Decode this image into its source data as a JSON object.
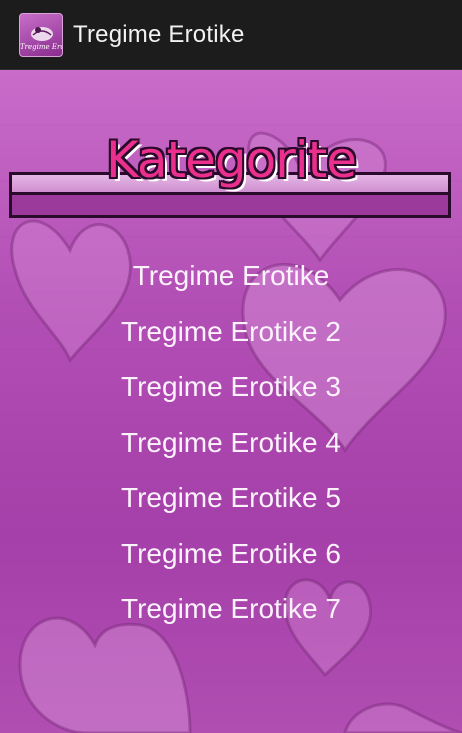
{
  "app": {
    "title": "Tregime Erotike",
    "icon_caption": "Tregime Erotike"
  },
  "banner": {
    "title": "Kategorite"
  },
  "categories": [
    "Tregime Erotike",
    "Tregime Erotike 2",
    "Tregime Erotike 3",
    "Tregime Erotike 4",
    "Tregime Erotike 5",
    "Tregime Erotike 6",
    "Tregime Erotike 7"
  ],
  "colors": {
    "action_bar": "#1c1c1c",
    "background": "#b24fb5",
    "banner_title": "#ea2f8c",
    "banner_bar": "#9c3a9c",
    "menu_text": "#fbf2fb"
  }
}
